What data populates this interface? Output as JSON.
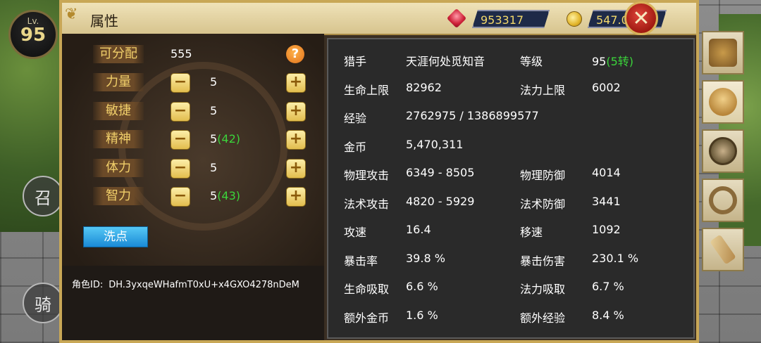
{
  "level": {
    "prefix": "Lv.",
    "value": "95"
  },
  "side_buttons": {
    "summon": "召",
    "ride": "骑"
  },
  "panel": {
    "title": "属性"
  },
  "resources": {
    "gems": "953317",
    "gold": "547.0w"
  },
  "attributes": {
    "available_label": "可分配",
    "available_value": "555",
    "stats": [
      {
        "label": "力量",
        "value": "5",
        "bonus": ""
      },
      {
        "label": "敏捷",
        "value": "5",
        "bonus": ""
      },
      {
        "label": "精神",
        "value": "5",
        "bonus": "(42)"
      },
      {
        "label": "体力",
        "value": "5",
        "bonus": ""
      },
      {
        "label": "智力",
        "value": "5",
        "bonus": "(43)"
      }
    ],
    "reset_button": "洗点",
    "role_id_label": "角色ID:",
    "role_id_value": "DH.3yxqeWHafmT0xU+x4GXO4278nDeM"
  },
  "info": {
    "class_label": "猎手",
    "name": "天涯何处觅知音",
    "level_label": "等级",
    "level_value": "95",
    "rebirth": "(5转)",
    "hp_label": "生命上限",
    "hp_value": "82962",
    "mp_label": "法力上限",
    "mp_value": "6002",
    "exp_label": "经验",
    "exp_value": "2762975 / 1386899577",
    "gold_label": "金币",
    "gold_value": "5,470,311",
    "patk_label": "物理攻击",
    "patk_value": "6349 - 8505",
    "pdef_label": "物理防御",
    "pdef_value": "4014",
    "matk_label": "法术攻击",
    "matk_value": "4820 - 5929",
    "mdef_label": "法术防御",
    "mdef_value": "3441",
    "aspd_label": "攻速",
    "aspd_value": "16.4",
    "mspd_label": "移速",
    "mspd_value": "1092",
    "crit_label": "暴击率",
    "crit_value": "39.8 %",
    "critdmg_label": "暴击伤害",
    "critdmg_value": "230.1 %",
    "lifesteal_label": "生命吸取",
    "lifesteal_value": "6.6 %",
    "manasteal_label": "法力吸取",
    "manasteal_value": "6.7 %",
    "extragold_label": "额外金币",
    "extragold_value": "1.6 %",
    "extraexp_label": "额外经验",
    "extraexp_value": "8.4 %"
  },
  "tabs": [
    "bag-icon",
    "character-portrait-icon",
    "dragon-emblem-icon",
    "ring-icon",
    "scroll-icon"
  ],
  "colors": {
    "accent_green": "#3bd43b",
    "gold_text": "#f1cf6a",
    "frame": "#c8a756"
  }
}
